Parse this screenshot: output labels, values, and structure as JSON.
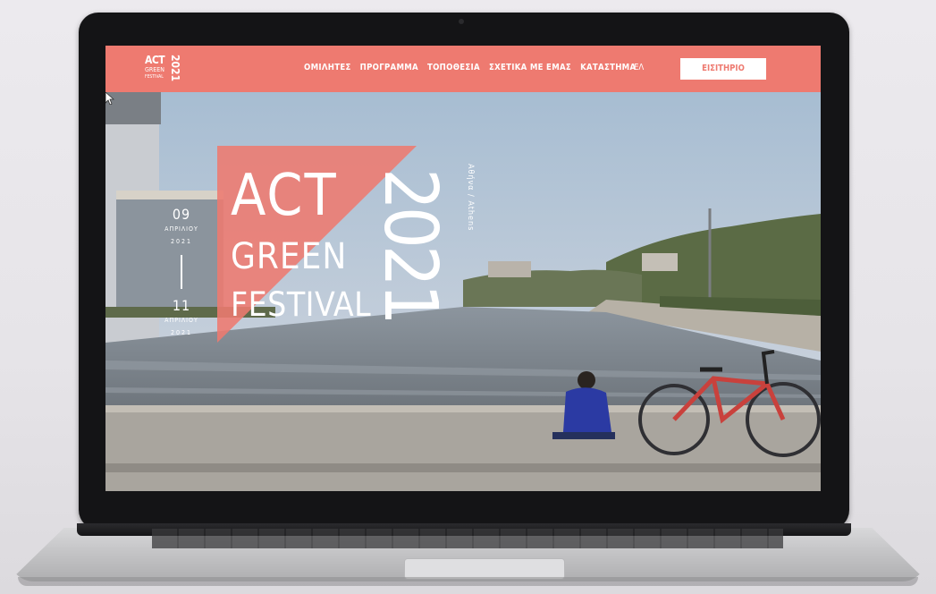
{
  "brand": {
    "logo_line1": "ACT",
    "logo_line2": "GREEN",
    "logo_line3": "FESTIVAL",
    "logo_year": "2021"
  },
  "nav": {
    "items": [
      {
        "label": "ΟΜΙΛΗΤΕΣ"
      },
      {
        "label": "ΠΡΟΓΡΑΜΜΑ"
      },
      {
        "label": "ΤΟΠΟΘΕΣΙΑ"
      },
      {
        "label": "ΣΧΕΤΙΚΑ ΜΕ ΕΜΑΣ"
      },
      {
        "label": "ΚΑΤΑΣΤΗΜΑ"
      }
    ],
    "language": "ΕΛ",
    "ticket_button": "ΕΙΣΙΤΗΡΙΟ"
  },
  "hero": {
    "start_day": "09",
    "start_month": "ΑΠΡΙΛΙΟΥ",
    "start_year": "2021",
    "end_day": "11",
    "end_month": "ΑΠΡΙΛΙΟΥ",
    "end_year": "2021",
    "title_word1": "ACT",
    "title_word2": "GREEN",
    "title_word3": "FESTIVAL",
    "title_year": "2021",
    "city": "Αθήνα / Athens"
  },
  "colors": {
    "accent": "#ee7a70",
    "text_light": "#ffffff",
    "device_frame": "#141416"
  }
}
